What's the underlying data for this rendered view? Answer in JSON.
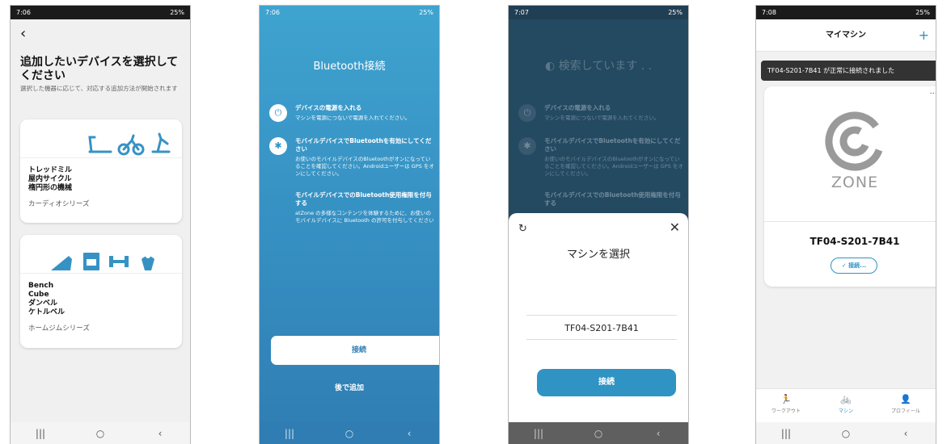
{
  "screen1": {
    "status": {
      "time": "7:06",
      "battery": "25%"
    },
    "title": "追加したいデバイスを選択してください",
    "subtitle": "選択した機器に応じて、対応する追加方法が開始されます",
    "cards": [
      {
        "names": [
          "トレッドミル",
          "屋内サイクル",
          "楕円形の機械"
        ],
        "series": "カーディオシリーズ"
      },
      {
        "names": [
          "Bench",
          "Cube",
          "ダンベル",
          "ケトルベル"
        ],
        "series": "ホームジムシリーズ"
      }
    ]
  },
  "screen2": {
    "status": {
      "time": "7:06",
      "battery": "25%"
    },
    "title": "Bluetooth接続",
    "steps": [
      {
        "heading": "デバイスの電源を入れる",
        "body": "マシンを電源につないで電源を入れてください。"
      },
      {
        "heading": "モバイルデバイスでBluetoothを有効にしてください",
        "body": "お使いのモバイルデバイスのBluetoothがオンになっていることを確認してください。Androidユーザーは GPS をオンにしてください。"
      },
      {
        "heading": "モバイルデバイスでのBluetooth使用権限を付与する",
        "body": "atZone の多様なコンテンツを体験するために、お使いのモバイルデバイスに Bluetooth の許可を付与してください"
      }
    ],
    "connect_label": "接続",
    "later_label": "後で追加"
  },
  "screen3": {
    "status": {
      "time": "7:07",
      "battery": "25%"
    },
    "searching": "検索しています . .",
    "sheet_title": "マシンを選択",
    "device": "TF04-S201-7B41",
    "connect_label": "接続"
  },
  "screen4": {
    "status": {
      "time": "7:08",
      "battery": "25%"
    },
    "header_title": "マイマシン",
    "toast": "TF04-S201-7B41 が正常に接続されました",
    "brand": "ZONE",
    "machine_name": "TF04-S201-7B41",
    "connected_label": "接続...",
    "tabs": [
      {
        "label": "ワークアウト",
        "icon": "run-icon"
      },
      {
        "label": "マシン",
        "icon": "bike-icon"
      },
      {
        "label": "プロフィール",
        "icon": "person-icon"
      }
    ]
  },
  "colors": {
    "accent": "#2f93c3",
    "gradient_top": "#3fa3cf",
    "gradient_bottom": "#2f7db3",
    "dark_bg": "#244a62"
  }
}
